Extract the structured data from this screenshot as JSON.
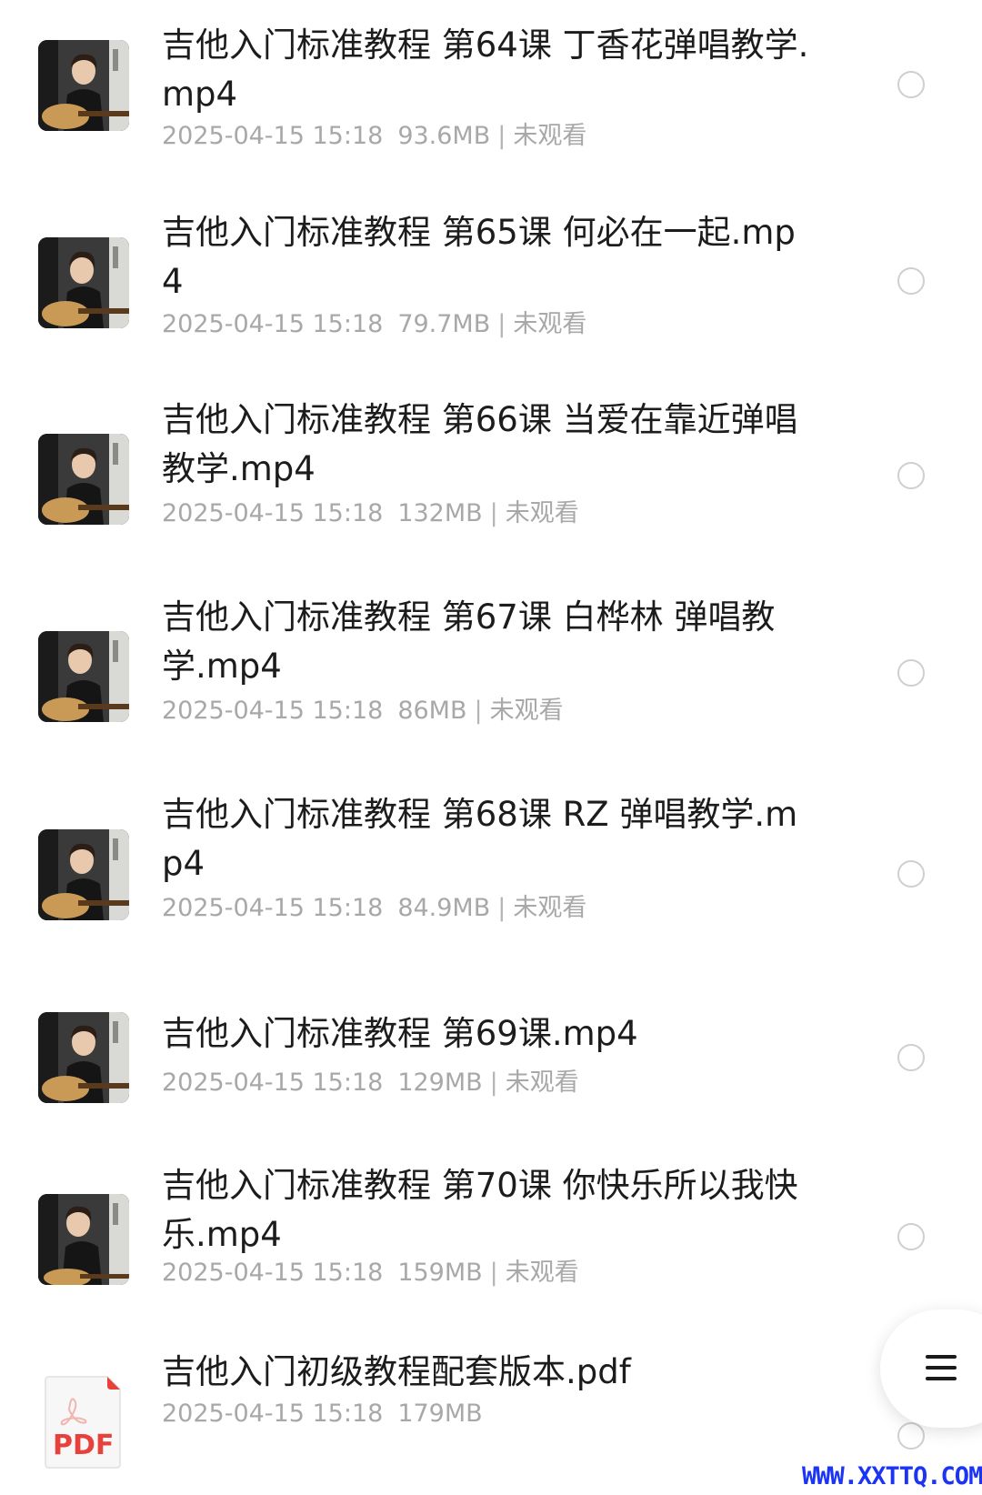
{
  "files": [
    {
      "name": "吉他入门标准教程 第64课 丁香花弹唱教学.mp4",
      "date": "2025-04-15 15:18",
      "size": "93.6MB",
      "status": "未观看",
      "thumbnail_icon": "video-thumbnail"
    },
    {
      "name": "吉他入门标准教程 第65课 何必在一起.mp4",
      "date": "2025-04-15 15:18",
      "size": "79.7MB",
      "status": "未观看",
      "thumbnail_icon": "video-thumbnail"
    },
    {
      "name": "吉他入门标准教程 第66课 当爱在靠近弹唱教学.mp4",
      "date": "2025-04-15 15:18",
      "size": "132MB",
      "status": "未观看",
      "thumbnail_icon": "video-thumbnail"
    },
    {
      "name": "吉他入门标准教程 第67课 白桦林 弹唱教学.mp4",
      "date": "2025-04-15 15:18",
      "size": "86MB",
      "status": "未观看",
      "thumbnail_icon": "video-thumbnail"
    },
    {
      "name": "吉他入门标准教程 第68课 RZ 弹唱教学.mp4",
      "date": "2025-04-15 15:18",
      "size": "84.9MB",
      "status": "未观看",
      "thumbnail_icon": "video-thumbnail"
    },
    {
      "name": "吉他入门标准教程 第69课.mp4",
      "date": "2025-04-15 15:18",
      "size": "129MB",
      "status": "未观看",
      "thumbnail_icon": "video-thumbnail"
    },
    {
      "name": "吉他入门标准教程 第70课 你快乐所以我快乐.mp4",
      "date": "2025-04-15 15:18",
      "size": "159MB",
      "status": "未观看",
      "thumbnail_icon": "video-thumbnail"
    },
    {
      "name": "吉他入门初级教程配套版本.pdf",
      "date": "2025-04-15 15:18",
      "size": "179MB",
      "thumbnail_icon": "pdf-icon",
      "thumbnail_label": "PDF"
    }
  ],
  "status_separator": "|",
  "fab_icon": "menu-icon",
  "watermark": "WWW.XXTTQ.COM",
  "colors": {
    "title": "#1c1c1c",
    "meta": "#a8a8a8",
    "radio_border": "#cfcfcf",
    "pdf_red": "#e8403a",
    "watermark": "#1c35f5"
  }
}
